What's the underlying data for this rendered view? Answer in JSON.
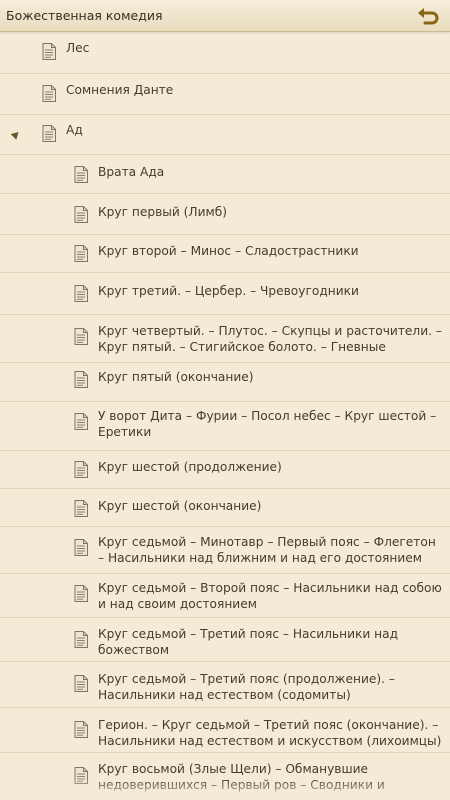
{
  "header": {
    "title": "Божественная комедия",
    "back_icon": "undo-arrow-icon"
  },
  "items": [
    {
      "label": "Лес",
      "level": 0
    },
    {
      "label": "Сомнения Данте",
      "level": 0
    },
    {
      "label": "Ад",
      "level": 0,
      "expanded": true
    },
    {
      "label": "Врата Ада",
      "level": 1
    },
    {
      "label": "Круг первый (Лимб)",
      "level": 1
    },
    {
      "label": "Круг второй – Минос – Сладострастники",
      "level": 1
    },
    {
      "label": "Круг третий. – Цербер. – Чревоугодники",
      "level": 1
    },
    {
      "label": "Круг четвертый. – Плутос. – Скупцы и расточители. – Круг пятый. – Стигийское болото. – Гневные",
      "level": 1
    },
    {
      "label": "Круг пятый (окончание)",
      "level": 1
    },
    {
      "label": "У ворот Дита – Фурии – Посол небес – Круг шестой – Еретики",
      "level": 1
    },
    {
      "label": "Круг шестой (продолжение)",
      "level": 1
    },
    {
      "label": "Круг шестой (окончание)",
      "level": 1
    },
    {
      "label": "Круг седьмой – Минотавр – Первый пояс – Флегетон – Насильники над ближним и над его достоянием",
      "level": 1
    },
    {
      "label": "Круг седьмой – Второй пояс – Насильники над собою и над своим достоянием",
      "level": 1
    },
    {
      "label": "Круг седьмой – Третий пояс – Насильники над божеством",
      "level": 1
    },
    {
      "label": "Круг седьмой – Третий пояс (продолжение). – Насильники над естеством (содомиты)",
      "level": 1
    },
    {
      "label": "Герион. – Круг седьмой – Третий пояс (окончание). – Насильники над естеством и искусством (лихоимцы)",
      "level": 1
    },
    {
      "label": "Круг восьмой (Злые Щели) – Обманувшие недоверившихся – Первый ров – Сводники и",
      "level": 1
    }
  ]
}
